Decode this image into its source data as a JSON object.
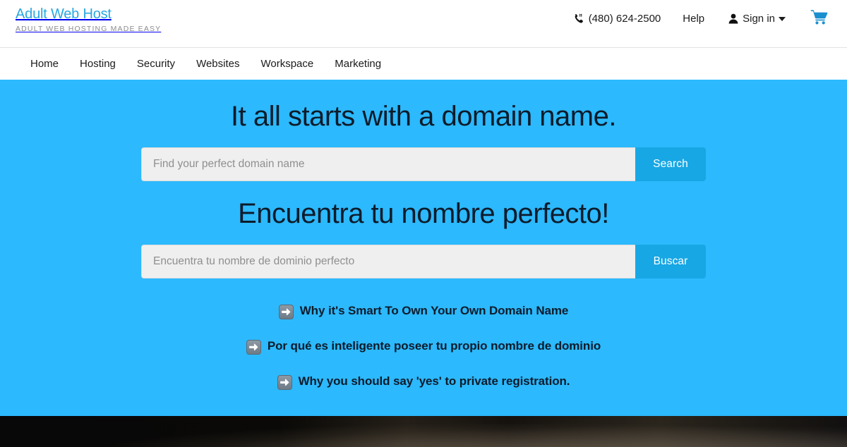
{
  "brand": {
    "name": "Adult Web Host",
    "tagline": "ADULT WEB HOSTING MADE EASY",
    "color": "#2aa8e0"
  },
  "header": {
    "phone": "(480) 624-2500",
    "phone_icon": "phone-icon",
    "help_label": "Help",
    "signin_label": "Sign in",
    "signin_icon": "user-icon",
    "cart_icon": "shopping-cart-icon",
    "cart_color": "#1a8fd0"
  },
  "nav": {
    "items": [
      {
        "label": "Home"
      },
      {
        "label": "Hosting"
      },
      {
        "label": "Security"
      },
      {
        "label": "Websites"
      },
      {
        "label": "Workspace"
      },
      {
        "label": "Marketing"
      }
    ]
  },
  "hero": {
    "background_color": "#2cb9fd",
    "title_en": "It all starts with a domain name.",
    "title_es": "Encuentra tu nombre perfecto!",
    "search_en": {
      "placeholder": "Find your perfect domain name",
      "value": "",
      "button_label": "Search"
    },
    "search_es": {
      "placeholder": "Encuentra tu nombre de dominio perfecto",
      "value": "",
      "button_label": "Buscar"
    },
    "button_color": "#17a7e4",
    "promo_links": [
      {
        "icon": "right-arrow-icon",
        "label": "Why it's Smart To Own Your Own Domain Name"
      },
      {
        "icon": "right-arrow-icon",
        "label": "Por qué es inteligente poseer tu propio nombre de dominio"
      },
      {
        "icon": "right-arrow-icon",
        "label": "Why you should say 'yes' to private registration."
      }
    ]
  }
}
